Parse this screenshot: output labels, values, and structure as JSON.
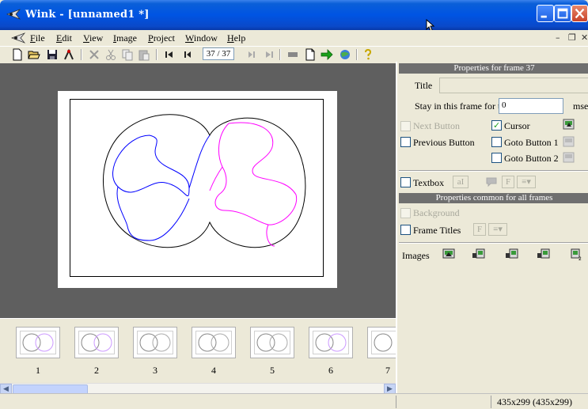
{
  "window": {
    "title": "Wink - [unnamed1 *]"
  },
  "menu": {
    "items": [
      "File",
      "Edit",
      "View",
      "Image",
      "Project",
      "Window",
      "Help"
    ]
  },
  "toolbar": {
    "frame_counter": "37 / 37"
  },
  "filmstrip": {
    "labels": [
      "1",
      "2",
      "3",
      "4",
      "5",
      "6",
      "7"
    ]
  },
  "frame_properties": {
    "header": "Properties for frame 37",
    "title_label": "Title",
    "title_value": "",
    "stay_label": "Stay in this frame for time",
    "stay_value": "0",
    "stay_unit": "msec",
    "next_button_label": "Next Button",
    "previous_button_label": "Previous Button",
    "cursor_label": "Cursor",
    "goto1_label": "Goto Button 1",
    "goto2_label": "Goto Button 2",
    "textbox_label": "Textbox",
    "cursor_checked": true,
    "next_button_checked": false,
    "previous_button_checked": false,
    "goto1_checked": false,
    "goto2_checked": false,
    "textbox_checked": false
  },
  "common_properties": {
    "header": "Properties common for all frames",
    "background_label": "Background",
    "frame_titles_label": "Frame Titles",
    "images_label": "Images"
  },
  "status": {
    "size": "435x299 (435x299)"
  },
  "colors": {
    "blue_curve": "#0000ff",
    "magenta_curve": "#ff00ff",
    "titlebar": "#0054e3",
    "canvas_bg": "#5f5f5f"
  }
}
